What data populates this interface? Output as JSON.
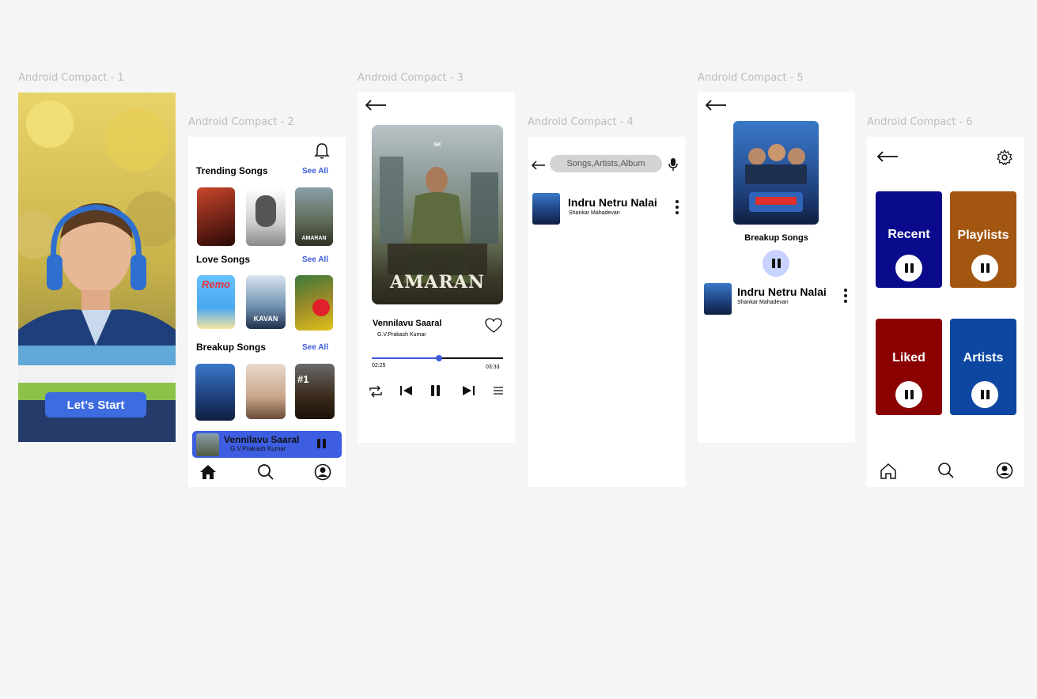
{
  "frames": {
    "f1": {
      "label": "Android Compact - 1"
    },
    "f2": {
      "label": "Android Compact - 2"
    },
    "f3": {
      "label": "Android Compact - 3"
    },
    "f4": {
      "label": "Android Compact - 4"
    },
    "f5": {
      "label": "Android Compact - 5"
    },
    "f6": {
      "label": "Android Compact - 6"
    }
  },
  "splash": {
    "start_button": "Let’s Start"
  },
  "home": {
    "sections": [
      {
        "title": "Trending Songs",
        "see_all": "See All",
        "covers": [
          "Rajinikanth film poster",
          "Vijay film poster",
          "AMARAN"
        ]
      },
      {
        "title": "Love Songs",
        "see_all": "See All",
        "covers": [
          "Remo",
          "KAVAN",
          "Love film poster"
        ]
      },
      {
        "title": "Breakup Songs",
        "see_all": "See All",
        "covers": [
          "Group film poster",
          "Paiya",
          "#1 Trending film poster"
        ]
      }
    ],
    "cover_texts": {
      "amaran": "AMARAN",
      "remo": "Remo",
      "kavan": "KAVAN",
      "trending": "#1"
    },
    "mini_player": {
      "title": "Vennilavu Saaral",
      "artist": "G.V.Prakash Kumar"
    },
    "nav": [
      "home-icon",
      "search-icon",
      "profile-icon"
    ]
  },
  "player": {
    "poster_title": "AMARAN",
    "poster_top": "SK",
    "title": "Vennilavu Saaral",
    "artist": "G.V.Prakash Kumar",
    "elapsed": "02:25",
    "duration": "03:33",
    "progress": 0.51
  },
  "search": {
    "placeholder": "Songs,Artists,Album",
    "result": {
      "title": "Indru Netru Nalai",
      "artist": "Shankar Mahadevan"
    }
  },
  "album": {
    "name": "Breakup Songs",
    "track": {
      "title": "Indru Netru Nalai",
      "artist": "Shankar Mahadevan"
    }
  },
  "library": {
    "tiles": [
      {
        "label": "Recent",
        "color": "#0a0a8c"
      },
      {
        "label": "Playlists",
        "color": "#a3560f"
      },
      {
        "label": "Liked",
        "color": "#8b0000"
      },
      {
        "label": "Artists",
        "color": "#0d47a1"
      }
    ]
  },
  "colors": {
    "accent": "#3b5bdb",
    "mini_player": "#3d5ee0"
  }
}
